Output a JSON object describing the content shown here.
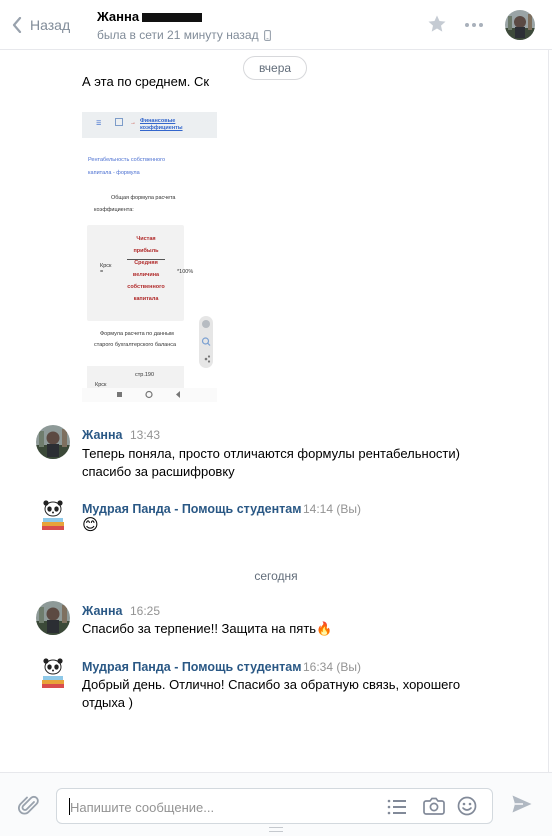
{
  "header": {
    "back_label": "Назад",
    "contact_name": "Жанна",
    "status": "была в сети 21 минуту назад"
  },
  "dates": {
    "yesterday": "вчера",
    "today": "сегодня"
  },
  "messages": [
    {
      "text": "А эта по среднем. Ск"
    },
    {
      "author": "Жанна",
      "time": "13:43",
      "lines": [
        "Теперь поняла, просто отличаются формулы рентабельности)",
        "спасибо за расшифровку"
      ]
    },
    {
      "author": "Мудрая Панда - Помощь студентам",
      "time": "14:14 (Вы)",
      "emoji": "😊"
    },
    {
      "author": "Жанна",
      "time": "16:25",
      "text": "Спасибо за терпение!! Защита на пять",
      "emoji": "🔥"
    },
    {
      "author": "Мудрая Панда - Помощь студентам",
      "time": "16:34 (Вы)",
      "lines": [
        "Добрый день. Отлично! Спасибо за обратную связь, хорошего",
        "отдыха )"
      ]
    }
  ],
  "attachment": {
    "nav_link": "Финансовые коэффициенты",
    "heading": [
      "Рентабельность собственного",
      "капитала - формула"
    ],
    "intro": [
      "Общая формула расчета",
      "коэффициента:"
    ],
    "formula": [
      "Чистая",
      "прибыль",
      "Средняя",
      "величина",
      "собственного",
      "капитала"
    ],
    "k_label": "Крск",
    "eq": "=",
    "pct": "*100%",
    "footer": [
      "Формула расчета по данным",
      "старого бухгалтерского баланса"
    ],
    "row_label": "стр.190",
    "k2": "Крск"
  },
  "composer": {
    "placeholder": "Напишите сообщение..."
  },
  "colors": {
    "link": "#2a5885",
    "muted": "#818c99",
    "border": "#e7e8ec"
  }
}
